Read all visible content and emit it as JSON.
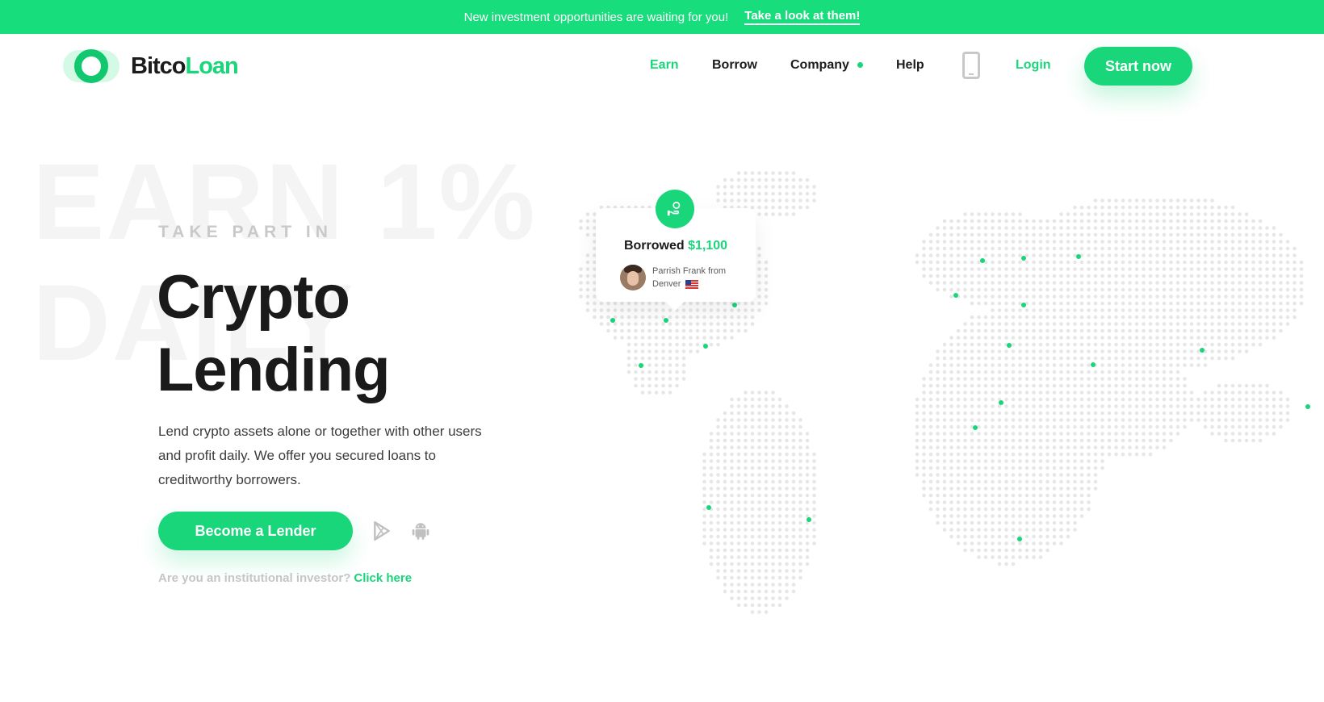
{
  "banner": {
    "message": "New investment opportunities are waiting for you!",
    "link": "Take a look at them!"
  },
  "brand": {
    "part1": "Bitco",
    "part2": "Loan"
  },
  "nav": {
    "items": [
      {
        "label": "Earn",
        "active": true
      },
      {
        "label": "Borrow",
        "active": false
      },
      {
        "label": "Company",
        "active": false
      },
      {
        "label": "Help",
        "active": false
      }
    ],
    "login": "Login",
    "start": "Start now"
  },
  "hero": {
    "bg_line1": "EARN 1%",
    "bg_line2": "DAILY",
    "eyebrow": "TAKE PART IN",
    "title_line1": "Crypto",
    "title_line2": "Lending",
    "description": "Lend crypto assets alone or together with other users and profit daily. We offer you secured loans to creditworthy borrowers.",
    "cta": "Become a Lender",
    "institutional_text": "Are you an institutional investor?",
    "institutional_link": "Click here"
  },
  "card": {
    "label": "Borrowed",
    "amount": "$1,100",
    "user_line1": "Parrish Frank from",
    "user_line2": "Denver"
  },
  "colors": {
    "accent": "#19d67a",
    "banner": "#18dd7c",
    "text": "#1c1c1c",
    "muted": "#c5c5c5"
  }
}
